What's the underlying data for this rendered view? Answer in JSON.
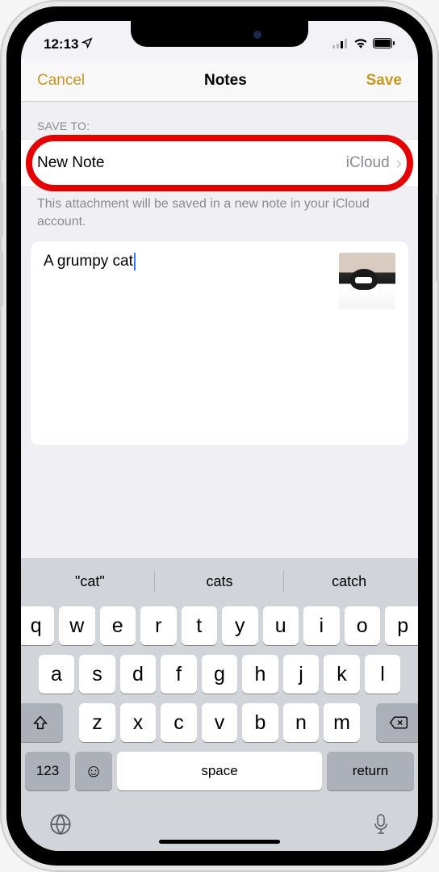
{
  "status": {
    "time": "12:13",
    "loc_icon": "nav-arrow"
  },
  "nav": {
    "cancel": "Cancel",
    "title": "Notes",
    "save": "Save"
  },
  "saveTo": {
    "header": "SAVE TO:",
    "label": "New Note",
    "destination": "iCloud",
    "help": "This attachment will be saved in a new note in your iCloud account."
  },
  "note": {
    "text": "A grumpy cat",
    "thumb_alt": "cat-photo"
  },
  "keyboard": {
    "suggestions": [
      "\"cat\"",
      "cats",
      "catch"
    ],
    "row1": [
      "q",
      "w",
      "e",
      "r",
      "t",
      "y",
      "u",
      "i",
      "o",
      "p"
    ],
    "row2": [
      "a",
      "s",
      "d",
      "f",
      "g",
      "h",
      "j",
      "k",
      "l"
    ],
    "row3": [
      "z",
      "x",
      "c",
      "v",
      "b",
      "n",
      "m"
    ],
    "num": "123",
    "space": "space",
    "return": "return"
  }
}
